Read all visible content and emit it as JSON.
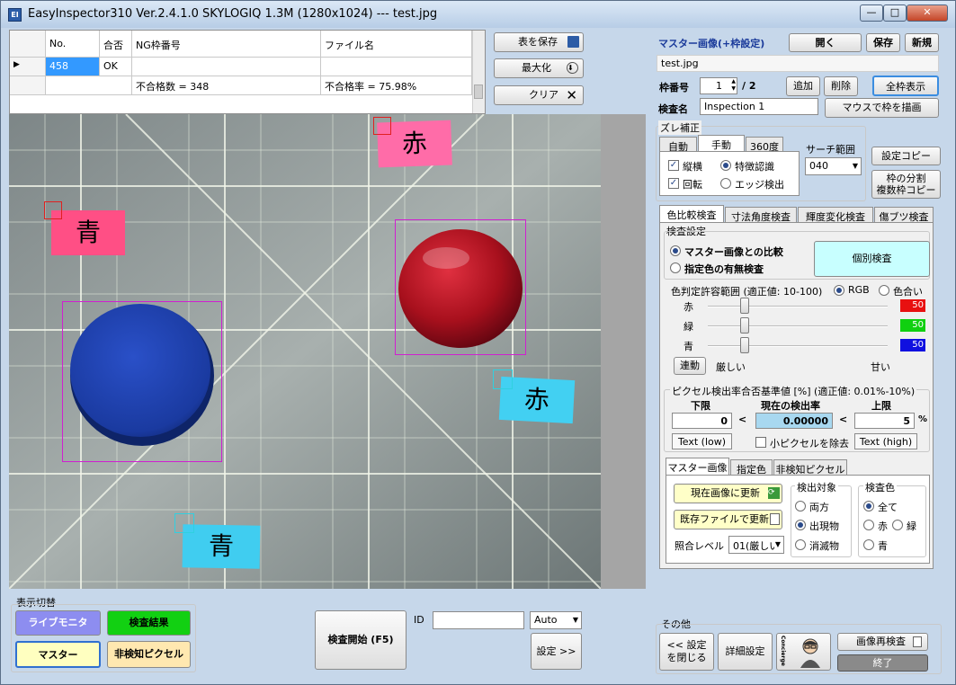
{
  "window": {
    "title": "EasyInspector310 Ver.2.4.1.0 SKYLOGIQ 1.3M  (1280x1024) --- test.jpg",
    "app_icon": "EI",
    "min": "—",
    "max": "□",
    "close": "✕"
  },
  "table": {
    "headers": [
      "No.",
      "合否",
      "NG枠番号",
      "ファイル名"
    ],
    "rows": [
      {
        "no": "458",
        "result": "OK",
        "ng": "",
        "file": ""
      }
    ],
    "summary": {
      "fail_count": "不合格数 = 348",
      "fail_rate": "不合格率 = 75.98%"
    }
  },
  "table_buttons": {
    "save": "表を保存",
    "maximize": "最大化",
    "clear": "クリア"
  },
  "right": {
    "master_title": "マスター画像(+枠設定)",
    "open": "開く",
    "save": "保存",
    "new": "新規",
    "filename": "test.jpg",
    "frame_no_label": "枠番号",
    "frame_no": "1",
    "frame_total": "/ 2",
    "add": "追加",
    "delete": "削除",
    "show_all": "全枠表示",
    "inspect_name_label": "検査名",
    "inspect_name": "Inspection 1",
    "draw_mouse": "マウスで枠を描画",
    "offset": {
      "title": "ズレ補正",
      "tabs": [
        "自動",
        "手動",
        "360度"
      ],
      "checks": [
        "縦横",
        "回転"
      ],
      "radios": [
        "特徴認識",
        "エッジ検出"
      ],
      "search_label": "サーチ範囲",
      "search_value": "040"
    },
    "copy_settings": "設定コピー",
    "split_copy": [
      "枠の分割",
      "複数枠コピー"
    ],
    "main_tabs": [
      "色比較検査",
      "寸法角度検査",
      "輝度変化検査",
      "傷ブツ検査"
    ],
    "settings_title": "検査設定",
    "mode": [
      "マスター画像との比較",
      "指定色の有無検査"
    ],
    "individual": "個別検査",
    "tolerance_title": "色判定許容範囲 (適正値: 10-100)",
    "tol_modes": [
      "RGB",
      "色合い"
    ],
    "channels": [
      {
        "name": "赤",
        "value": "50",
        "color": "#e81010"
      },
      {
        "name": "緑",
        "value": "50",
        "color": "#10d010"
      },
      {
        "name": "青",
        "value": "50",
        "color": "#1010e0"
      }
    ],
    "link": "連動",
    "strict": "厳しい",
    "loose": "甘い",
    "pixel_title": "ピクセル検出率合否基準値 [%] (適正値: 0.01%-10%)",
    "lower_label": "下限",
    "current_label": "現在の検出率",
    "upper_label": "上限",
    "lower": "0",
    "current": "0.00000",
    "upper": "5",
    "pct": "%",
    "lt": "<",
    "text_low": "Text (low)",
    "text_high": "Text (high)",
    "remove_small": "小ピクセルを除去",
    "sub_tabs": [
      "マスター画像",
      "指定色",
      "非検知ピクセル"
    ],
    "update_current": "現在画像に更新",
    "update_file": "既存ファイルで更新",
    "match_label": "照合レベル",
    "match_value": "01(厳しい",
    "detect_title": "検出対象",
    "detect": [
      "両方",
      "出現物",
      "消滅物"
    ],
    "color_title": "検査色",
    "colors": [
      "全て",
      "赤",
      "緑",
      "青"
    ],
    "other": "その他",
    "close_settings": [
      "<< 設定",
      "を閉じる"
    ],
    "detail": "詳細設定",
    "concierge": "Concierge",
    "reinspect": "画像再検査",
    "exit": "終了"
  },
  "bottom": {
    "view_switch": "表示切替",
    "live": "ライブモニタ",
    "result": "検査結果",
    "master": "マスター",
    "undetected": "非検知ピクセル",
    "start": "検査開始 (F5)",
    "id_label": "ID",
    "id_value": "",
    "auto": "Auto",
    "settings": "設定 >>"
  },
  "image": {
    "notes": [
      {
        "text": "赤",
        "kind": "pink"
      },
      {
        "text": "青",
        "kind": "pink"
      },
      {
        "text": "赤",
        "kind": "cyan"
      },
      {
        "text": "青",
        "kind": "cyan"
      }
    ]
  }
}
